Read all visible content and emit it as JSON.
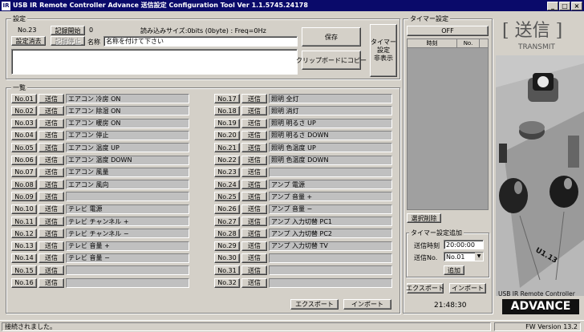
{
  "window": {
    "title": "USB IR Remote Controller Advance 送信設定 Configuration Tool Ver 1.1.5745.24178",
    "icon": "IR",
    "min_glyph": "_",
    "max_glyph": "□",
    "close_glyph": "×"
  },
  "settings": {
    "group_label": "設定",
    "current_no": "No.23",
    "record_start": "記録開始",
    "record_stop": "記録停止",
    "clear_settings": "設定消去",
    "record_value": "0",
    "read_size": "読み込みサイズ:0bits (0byte) : Freq=0Hz",
    "name_label": "名称",
    "name_value": "名称を付けて下さい",
    "save": "保存",
    "copy_clipboard": "クリップボードにコピー",
    "timer_toggle": "タイマー\n設定\n非表示"
  },
  "list": {
    "group_label": "一覧",
    "send_label": "送信",
    "items": [
      {
        "no": "No.01",
        "name": "エアコン 冷房 ON"
      },
      {
        "no": "No.02",
        "name": "エアコン 除湿 ON"
      },
      {
        "no": "No.03",
        "name": "エアコン 暖房 ON"
      },
      {
        "no": "No.04",
        "name": "エアコン 停止"
      },
      {
        "no": "No.05",
        "name": "エアコン 温度 UP"
      },
      {
        "no": "No.06",
        "name": "エアコン 温度 DOWN"
      },
      {
        "no": "No.07",
        "name": "エアコン 風量"
      },
      {
        "no": "No.08",
        "name": "エアコン 風向"
      },
      {
        "no": "No.09",
        "name": ""
      },
      {
        "no": "No.10",
        "name": "テレビ 電源"
      },
      {
        "no": "No.11",
        "name": "テレビ チャンネル +"
      },
      {
        "no": "No.12",
        "name": "テレビ チャンネル −"
      },
      {
        "no": "No.13",
        "name": "テレビ 音量 +"
      },
      {
        "no": "No.14",
        "name": "テレビ 音量 −"
      },
      {
        "no": "No.15",
        "name": ""
      },
      {
        "no": "No.16",
        "name": ""
      },
      {
        "no": "No.17",
        "name": "照明 全灯"
      },
      {
        "no": "No.18",
        "name": "照明 消灯"
      },
      {
        "no": "No.19",
        "name": "照明 明るさ UP"
      },
      {
        "no": "No.20",
        "name": "照明 明るさ DOWN"
      },
      {
        "no": "No.21",
        "name": "照明 色温度 UP"
      },
      {
        "no": "No.22",
        "name": "照明 色温度 DOWN"
      },
      {
        "no": "No.23",
        "name": ""
      },
      {
        "no": "No.24",
        "name": "アンプ 電源"
      },
      {
        "no": "No.25",
        "name": "アンプ 音量 +"
      },
      {
        "no": "No.26",
        "name": "アンプ 音量 −"
      },
      {
        "no": "No.27",
        "name": "アンプ 入力切替 PC1"
      },
      {
        "no": "No.28",
        "name": "アンプ 入力切替 PC2"
      },
      {
        "no": "No.29",
        "name": "アンプ 入力切替 TV"
      },
      {
        "no": "No.30",
        "name": ""
      },
      {
        "no": "No.31",
        "name": ""
      },
      {
        "no": "No.32",
        "name": ""
      }
    ],
    "export": "エクスポート",
    "import": "インポート"
  },
  "timer": {
    "group_label": "タイマー設定",
    "toggle": "OFF",
    "col_time": "時刻",
    "col_no": "No.",
    "delete_selected": "選択削除",
    "add_group_label": "タイマー設定追加",
    "send_time_label": "送信時刻",
    "send_time_value": "20:00:00",
    "send_no_label": "送信No.",
    "send_no_value": "No.01",
    "add": "追加",
    "export": "エクスポート",
    "import": "インポート",
    "clock": "21:48:30"
  },
  "brand": {
    "kanji": "[ 送信 ]",
    "sub": "TRANSMIT",
    "product": "USB IR Remote Controller",
    "advance": "ADVANCE",
    "version_mark": "U1.13"
  },
  "status": {
    "message": "接続されました。",
    "fw": "FW Version 13.2"
  }
}
